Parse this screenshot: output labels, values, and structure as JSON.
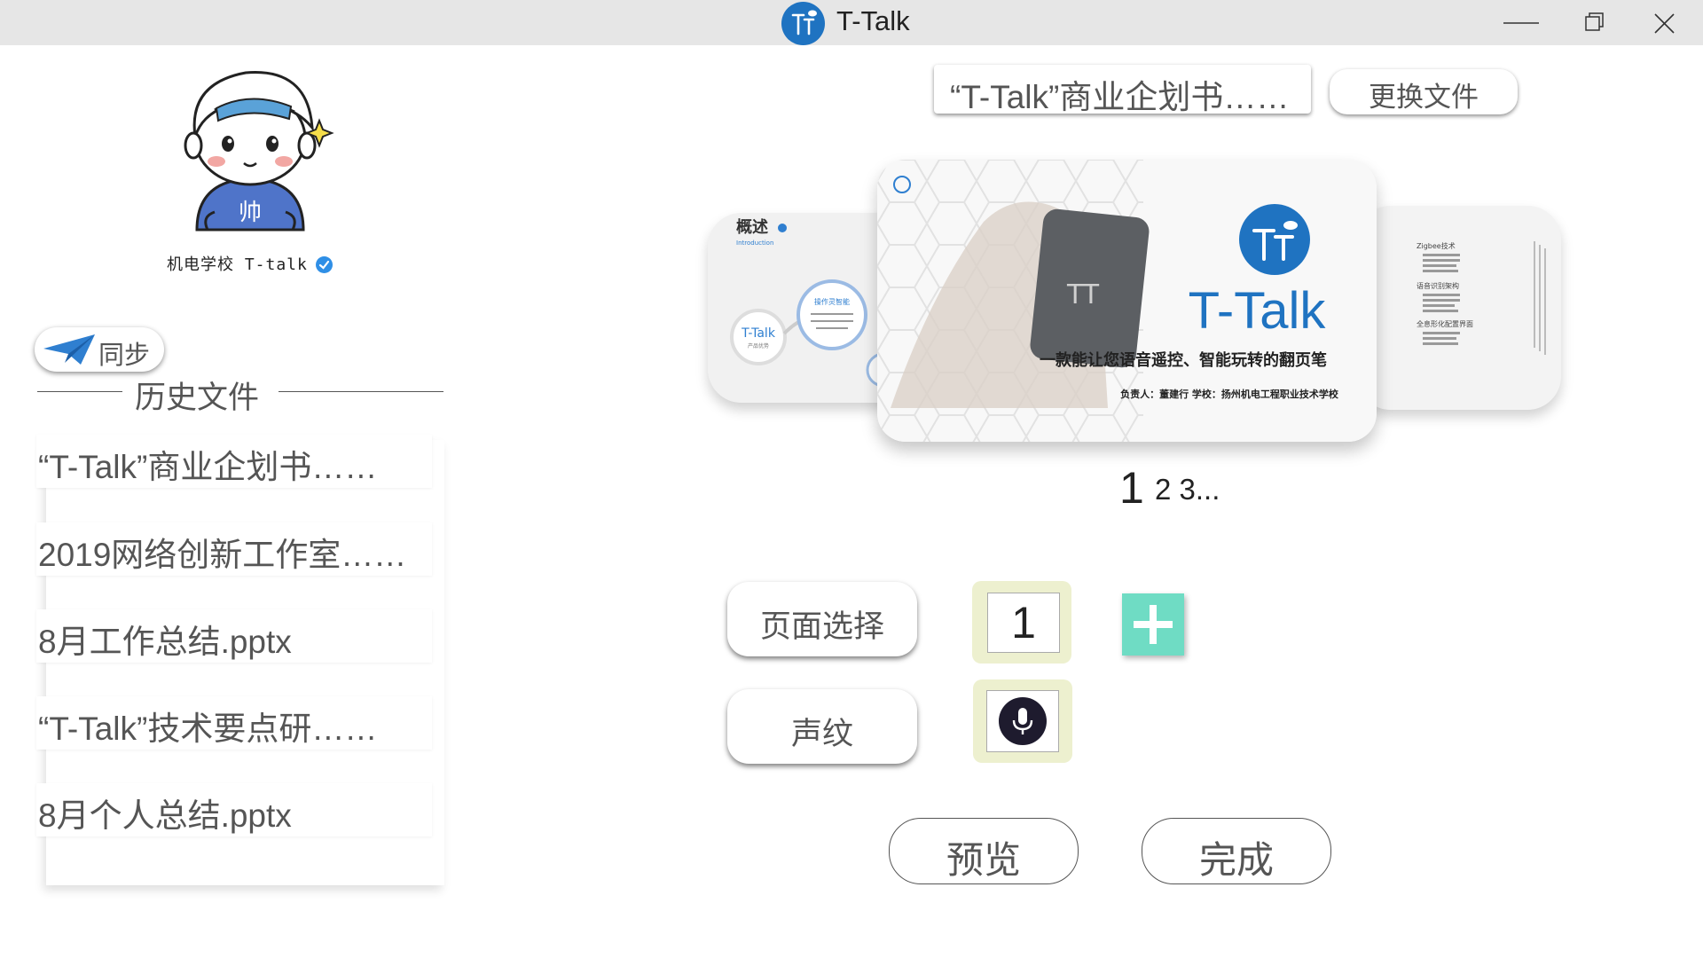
{
  "window": {
    "title": "T-Talk",
    "controls": [
      "minimize-icon",
      "restore-icon",
      "close-icon"
    ]
  },
  "profile": {
    "avatar_text": "帅",
    "username": "机电学校 T-talk",
    "verified": true
  },
  "sync_button": {
    "label": "同步",
    "icon": "paper-plane-icon"
  },
  "history": {
    "title": "历史文件",
    "items": [
      "“T-Talk”商业企划书……",
      "2019网络创新工作室……",
      "8月工作总结.pptx",
      "“T-Talk”技术要点研……",
      "8月个人总结.pptx"
    ]
  },
  "current_file": {
    "name": "“T-Talk”商业企划书……",
    "change_label": "更换文件"
  },
  "preview": {
    "left_slide": {
      "heading": "概述",
      "subheading": "Introduction",
      "node_main": "T-Talk",
      "node_main_sub": "产品优势",
      "node_top": "操作灵智能"
    },
    "main_slide": {
      "logo_text": "T-Talk",
      "tagline": "一款能让您语音遥控、智能玩转的翻页笔",
      "footer": "负责人：董建行   学校：扬州机电工程职业技术学校"
    },
    "right_slide": {
      "bullets": [
        "Zigbee技术",
        "语音识别架构",
        "全息形化配置界面"
      ]
    },
    "current_page": "1",
    "next_pages": "2 3..."
  },
  "controls": {
    "page_select_label": "页面选择",
    "page_input_value": "1",
    "voiceprint_label": "声纹",
    "add_icon": "plus-icon",
    "mic_icon": "microphone-icon",
    "preview_label": "预览",
    "done_label": "完成"
  },
  "colors": {
    "titlebar": "#e6e6e6",
    "brand_blue": "#1f73c1",
    "plus_green": "#6fdcc4",
    "input_highlight": "#edf0cf",
    "text_gray": "#555555"
  }
}
